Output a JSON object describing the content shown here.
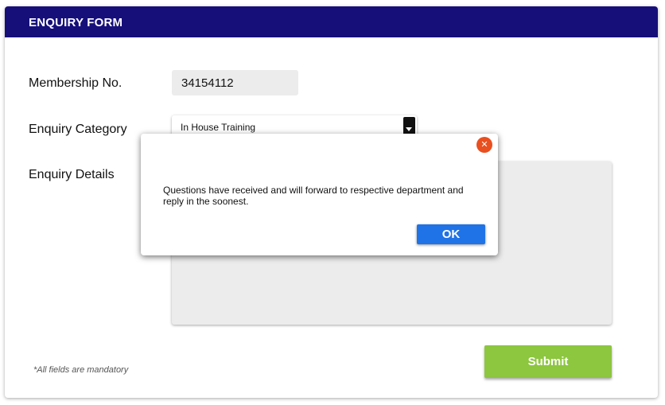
{
  "form": {
    "title": "ENQUIRY FORM",
    "membership_label": "Membership No.",
    "membership_value": "34154112",
    "category_label": "Enquiry Category",
    "category_value": "In House Training",
    "details_label": "Enquiry Details",
    "details_value": "",
    "mandatory_note": "*All fields are mandatory",
    "submit_label": "Submit"
  },
  "dialog": {
    "message": "Questions have received and will forward to respective department and reply in the soonest.",
    "ok_label": "OK",
    "close_icon": "close-icon"
  },
  "colors": {
    "header": "#160f7a",
    "submit": "#8dc63f",
    "ok_button": "#1f73e6",
    "close_button": "#ea4f1f"
  }
}
